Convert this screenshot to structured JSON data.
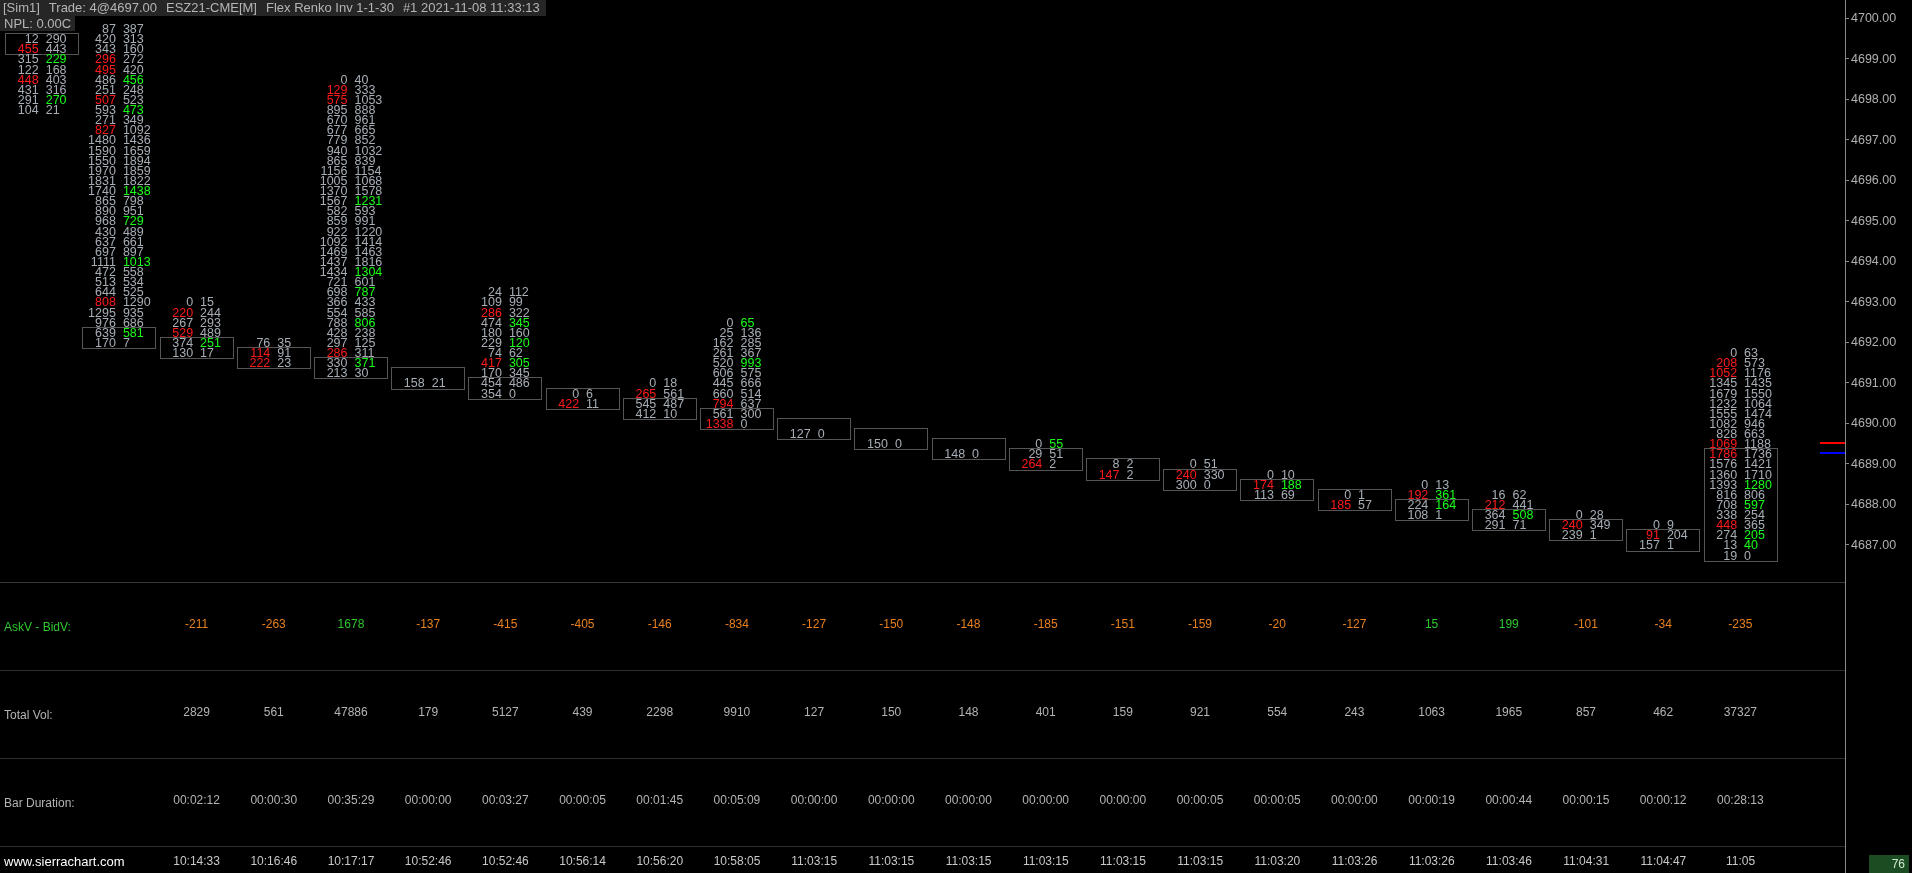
{
  "title_bar": {
    "segments": [
      "[Sim1]",
      "Trade: 4@4697.00",
      "ESZ21-CME[M]",
      "Flex Renko Inv 1-1-30",
      "#1 2021-11-08 11:33:13"
    ]
  },
  "npl": "NPL: 0.00C",
  "footprint": {
    "bars": [
      {
        "body": [
          {
            "bid": "12",
            "ask": "290",
            "bid_imb": false,
            "ask_imb": false
          },
          {
            "bid": "455",
            "ask": "443",
            "bid_imb": true,
            "ask_imb": false
          }
        ],
        "lower": [
          {
            "bid": "315",
            "ask": "229",
            "bid_imb": false,
            "ask_imb": true
          },
          {
            "bid": "122",
            "ask": "168",
            "bid_imb": false,
            "ask_imb": false
          },
          {
            "bid": "448",
            "ask": "403",
            "bid_imb": true,
            "ask_imb": false
          },
          {
            "bid": "431",
            "ask": "316",
            "bid_imb": false,
            "ask_imb": false
          },
          {
            "bid": "291",
            "ask": "270",
            "bid_imb": false,
            "ask_imb": true
          },
          {
            "bid": "104",
            "ask": "21",
            "bid_imb": false,
            "ask_imb": false
          }
        ]
      },
      {
        "upper": [
          {
            "bid": "87",
            "ask": "387",
            "bid_imb": false,
            "ask_imb": false
          },
          {
            "bid": "420",
            "ask": "313",
            "bid_imb": false,
            "ask_imb": false
          },
          {
            "bid": "343",
            "ask": "160",
            "bid_imb": false,
            "ask_imb": false
          },
          {
            "bid": "296",
            "ask": "272",
            "bid_imb": true,
            "ask_imb": false
          },
          {
            "bid": "495",
            "ask": "420",
            "bid_imb": true,
            "ask_imb": false
          },
          {
            "bid": "486",
            "ask": "456",
            "bid_imb": false,
            "ask_imb": true
          },
          {
            "bid": "251",
            "ask": "248",
            "bid_imb": false,
            "ask_imb": false
          },
          {
            "bid": "507",
            "ask": "523",
            "bid_imb": true,
            "ask_imb": false
          },
          {
            "bid": "593",
            "ask": "473",
            "bid_imb": false,
            "ask_imb": true
          },
          {
            "bid": "271",
            "ask": "349",
            "bid_imb": false,
            "ask_imb": false
          },
          {
            "bid": "827",
            "ask": "1092",
            "bid_imb": true,
            "ask_imb": false
          },
          {
            "bid": "1480",
            "ask": "1436",
            "bid_imb": false,
            "ask_imb": false
          },
          {
            "bid": "1590",
            "ask": "1659",
            "bid_imb": false,
            "ask_imb": false
          },
          {
            "bid": "1550",
            "ask": "1894",
            "bid_imb": false,
            "ask_imb": false
          },
          {
            "bid": "1970",
            "ask": "1859",
            "bid_imb": false,
            "ask_imb": false
          },
          {
            "bid": "1831",
            "ask": "1822",
            "bid_imb": false,
            "ask_imb": false
          },
          {
            "bid": "1740",
            "ask": "1438",
            "bid_imb": false,
            "ask_imb": true
          },
          {
            "bid": "865",
            "ask": "798",
            "bid_imb": false,
            "ask_imb": false
          },
          {
            "bid": "890",
            "ask": "951",
            "bid_imb": false,
            "ask_imb": false
          },
          {
            "bid": "968",
            "ask": "729",
            "bid_imb": false,
            "ask_imb": true
          },
          {
            "bid": "430",
            "ask": "489",
            "bid_imb": false,
            "ask_imb": false
          },
          {
            "bid": "637",
            "ask": "661",
            "bid_imb": false,
            "ask_imb": false
          },
          {
            "bid": "697",
            "ask": "897",
            "bid_imb": false,
            "ask_imb": false
          },
          {
            "bid": "1111",
            "ask": "1013",
            "bid_imb": false,
            "ask_imb": true
          },
          {
            "bid": "472",
            "ask": "558",
            "bid_imb": false,
            "ask_imb": false
          },
          {
            "bid": "513",
            "ask": "534",
            "bid_imb": false,
            "ask_imb": false
          },
          {
            "bid": "644",
            "ask": "525",
            "bid_imb": false,
            "ask_imb": false
          },
          {
            "bid": "808",
            "ask": "1290",
            "bid_imb": true,
            "ask_imb": false
          },
          {
            "bid": "1295",
            "ask": "935",
            "bid_imb": false,
            "ask_imb": false
          },
          {
            "bid": "976",
            "ask": "686",
            "bid_imb": false,
            "ask_imb": false
          }
        ],
        "body": [
          {
            "bid": "639",
            "ask": "581",
            "bid_imb": false,
            "ask_imb": true
          },
          {
            "bid": "170",
            "ask": "7",
            "bid_imb": false,
            "ask_imb": false
          }
        ]
      },
      {
        "upper": [
          {
            "bid": "0",
            "ask": "15",
            "bid_imb": false,
            "ask_imb": false
          },
          {
            "bid": "220",
            "ask": "244",
            "bid_imb": true,
            "ask_imb": false
          },
          {
            "bid": "267",
            "ask": "293",
            "bid_imb": false,
            "ask_imb": false
          },
          {
            "bid": "529",
            "ask": "489",
            "bid_imb": true,
            "ask_imb": false
          }
        ],
        "body": [
          {
            "bid": "374",
            "ask": "251",
            "bid_imb": false,
            "ask_imb": true
          },
          {
            "bid": "130",
            "ask": "17",
            "bid_imb": false,
            "ask_imb": false
          }
        ]
      },
      {
        "upper": [
          {
            "bid": "76",
            "ask": "35",
            "bid_imb": false,
            "ask_imb": false
          }
        ],
        "body": [
          {
            "bid": "114",
            "ask": "91",
            "bid_imb": true,
            "ask_imb": false
          },
          {
            "bid": "222",
            "ask": "23",
            "bid_imb": true,
            "ask_imb": false
          }
        ]
      },
      {
        "upper": [
          {
            "bid": "0",
            "ask": "40",
            "bid_imb": false,
            "ask_imb": false
          },
          {
            "bid": "129",
            "ask": "333",
            "bid_imb": true,
            "ask_imb": false
          },
          {
            "bid": "575",
            "ask": "1053",
            "bid_imb": true,
            "ask_imb": false
          },
          {
            "bid": "895",
            "ask": "888",
            "bid_imb": false,
            "ask_imb": false
          },
          {
            "bid": "670",
            "ask": "961",
            "bid_imb": false,
            "ask_imb": false
          },
          {
            "bid": "677",
            "ask": "665",
            "bid_imb": false,
            "ask_imb": false
          },
          {
            "bid": "779",
            "ask": "852",
            "bid_imb": false,
            "ask_imb": false
          },
          {
            "bid": "940",
            "ask": "1032",
            "bid_imb": false,
            "ask_imb": false
          },
          {
            "bid": "865",
            "ask": "839",
            "bid_imb": false,
            "ask_imb": false
          },
          {
            "bid": "1156",
            "ask": "1154",
            "bid_imb": false,
            "ask_imb": false
          },
          {
            "bid": "1005",
            "ask": "1068",
            "bid_imb": false,
            "ask_imb": false
          },
          {
            "bid": "1370",
            "ask": "1578",
            "bid_imb": false,
            "ask_imb": false
          },
          {
            "bid": "1567",
            "ask": "1231",
            "bid_imb": false,
            "ask_imb": true
          },
          {
            "bid": "582",
            "ask": "593",
            "bid_imb": false,
            "ask_imb": false
          },
          {
            "bid": "859",
            "ask": "991",
            "bid_imb": false,
            "ask_imb": false
          },
          {
            "bid": "922",
            "ask": "1220",
            "bid_imb": false,
            "ask_imb": false
          },
          {
            "bid": "1092",
            "ask": "1414",
            "bid_imb": false,
            "ask_imb": false
          },
          {
            "bid": "1469",
            "ask": "1463",
            "bid_imb": false,
            "ask_imb": false
          },
          {
            "bid": "1437",
            "ask": "1816",
            "bid_imb": false,
            "ask_imb": false
          },
          {
            "bid": "1434",
            "ask": "1304",
            "bid_imb": false,
            "ask_imb": true
          },
          {
            "bid": "721",
            "ask": "601",
            "bid_imb": false,
            "ask_imb": false
          },
          {
            "bid": "698",
            "ask": "787",
            "bid_imb": false,
            "ask_imb": true
          },
          {
            "bid": "366",
            "ask": "433",
            "bid_imb": false,
            "ask_imb": false
          },
          {
            "bid": "554",
            "ask": "585",
            "bid_imb": false,
            "ask_imb": false
          },
          {
            "bid": "788",
            "ask": "806",
            "bid_imb": false,
            "ask_imb": true
          },
          {
            "bid": "428",
            "ask": "238",
            "bid_imb": false,
            "ask_imb": false
          },
          {
            "bid": "297",
            "ask": "125",
            "bid_imb": false,
            "ask_imb": false
          },
          {
            "bid": "286",
            "ask": "311",
            "bid_imb": true,
            "ask_imb": false
          }
        ],
        "body": [
          {
            "bid": "330",
            "ask": "371",
            "bid_imb": false,
            "ask_imb": true
          },
          {
            "bid": "213",
            "ask": "30",
            "bid_imb": false,
            "ask_imb": false
          }
        ]
      },
      {
        "body": [
          {
            "bid": "158",
            "ask": "21",
            "bid_imb": false,
            "ask_imb": false
          }
        ]
      },
      {
        "upper": [
          {
            "bid": "24",
            "ask": "112",
            "bid_imb": false,
            "ask_imb": false
          },
          {
            "bid": "109",
            "ask": "99",
            "bid_imb": false,
            "ask_imb": false
          },
          {
            "bid": "286",
            "ask": "322",
            "bid_imb": true,
            "ask_imb": false
          },
          {
            "bid": "474",
            "ask": "345",
            "bid_imb": false,
            "ask_imb": true
          },
          {
            "bid": "180",
            "ask": "160",
            "bid_imb": false,
            "ask_imb": false
          },
          {
            "bid": "229",
            "ask": "120",
            "bid_imb": false,
            "ask_imb": true
          },
          {
            "bid": "74",
            "ask": "62",
            "bid_imb": false,
            "ask_imb": false
          },
          {
            "bid": "417",
            "ask": "305",
            "bid_imb": true,
            "ask_imb": true
          },
          {
            "bid": "170",
            "ask": "345",
            "bid_imb": false,
            "ask_imb": false
          }
        ],
        "body": [
          {
            "bid": "454",
            "ask": "486",
            "bid_imb": false,
            "ask_imb": false
          },
          {
            "bid": "354",
            "ask": "0",
            "bid_imb": false,
            "ask_imb": false
          }
        ]
      },
      {
        "body": [
          {
            "bid": "0",
            "ask": "6",
            "bid_imb": false,
            "ask_imb": false
          },
          {
            "bid": "422",
            "ask": "11",
            "bid_imb": true,
            "ask_imb": false
          }
        ]
      },
      {
        "upper": [
          {
            "bid": "0",
            "ask": "18",
            "bid_imb": false,
            "ask_imb": false
          },
          {
            "bid": "265",
            "ask": "561",
            "bid_imb": true,
            "ask_imb": false
          }
        ],
        "body": [
          {
            "bid": "545",
            "ask": "487",
            "bid_imb": false,
            "ask_imb": false
          },
          {
            "bid": "412",
            "ask": "10",
            "bid_imb": false,
            "ask_imb": false
          }
        ]
      },
      {
        "upper": [
          {
            "bid": "0",
            "ask": "65",
            "bid_imb": false,
            "ask_imb": true
          },
          {
            "bid": "25",
            "ask": "136",
            "bid_imb": false,
            "ask_imb": false
          },
          {
            "bid": "162",
            "ask": "285",
            "bid_imb": false,
            "ask_imb": false
          },
          {
            "bid": "261",
            "ask": "367",
            "bid_imb": false,
            "ask_imb": false
          },
          {
            "bid": "520",
            "ask": "993",
            "bid_imb": false,
            "ask_imb": true
          },
          {
            "bid": "606",
            "ask": "575",
            "bid_imb": false,
            "ask_imb": false
          },
          {
            "bid": "445",
            "ask": "666",
            "bid_imb": false,
            "ask_imb": false
          },
          {
            "bid": "660",
            "ask": "514",
            "bid_imb": false,
            "ask_imb": false
          },
          {
            "bid": "794",
            "ask": "637",
            "bid_imb": true,
            "ask_imb": false
          }
        ],
        "body": [
          {
            "bid": "561",
            "ask": "300",
            "bid_imb": false,
            "ask_imb": false
          },
          {
            "bid": "1338",
            "ask": "0",
            "bid_imb": true,
            "ask_imb": false
          }
        ]
      },
      {
        "body": [
          {
            "bid": "127",
            "ask": "0",
            "bid_imb": false,
            "ask_imb": false
          }
        ]
      },
      {
        "body": [
          {
            "bid": "150",
            "ask": "0",
            "bid_imb": false,
            "ask_imb": false
          }
        ]
      },
      {
        "body": [
          {
            "bid": "148",
            "ask": "0",
            "bid_imb": false,
            "ask_imb": false
          }
        ]
      },
      {
        "upper": [
          {
            "bid": "0",
            "ask": "55",
            "bid_imb": false,
            "ask_imb": true
          }
        ],
        "body": [
          {
            "bid": "29",
            "ask": "51",
            "bid_imb": false,
            "ask_imb": false
          },
          {
            "bid": "264",
            "ask": "2",
            "bid_imb": true,
            "ask_imb": false
          }
        ]
      },
      {
        "body": [
          {
            "bid": "8",
            "ask": "2",
            "bid_imb": false,
            "ask_imb": false
          },
          {
            "bid": "147",
            "ask": "2",
            "bid_imb": true,
            "ask_imb": false
          }
        ]
      },
      {
        "upper": [
          {
            "bid": "0",
            "ask": "51",
            "bid_imb": false,
            "ask_imb": false
          }
        ],
        "body": [
          {
            "bid": "240",
            "ask": "330",
            "bid_imb": true,
            "ask_imb": false
          },
          {
            "bid": "300",
            "ask": "0",
            "bid_imb": false,
            "ask_imb": false
          }
        ]
      },
      {
        "upper": [
          {
            "bid": "0",
            "ask": "10",
            "bid_imb": false,
            "ask_imb": false
          }
        ],
        "body": [
          {
            "bid": "174",
            "ask": "188",
            "bid_imb": true,
            "ask_imb": true
          },
          {
            "bid": "113",
            "ask": "69",
            "bid_imb": false,
            "ask_imb": false
          }
        ]
      },
      {
        "body": [
          {
            "bid": "0",
            "ask": "1",
            "bid_imb": false,
            "ask_imb": false
          },
          {
            "bid": "185",
            "ask": "57",
            "bid_imb": true,
            "ask_imb": false
          }
        ]
      },
      {
        "upper": [
          {
            "bid": "0",
            "ask": "13",
            "bid_imb": false,
            "ask_imb": false
          },
          {
            "bid": "192",
            "ask": "361",
            "bid_imb": true,
            "ask_imb": true
          }
        ],
        "body": [
          {
            "bid": "224",
            "ask": "164",
            "bid_imb": false,
            "ask_imb": true
          },
          {
            "bid": "108",
            "ask": "1",
            "bid_imb": false,
            "ask_imb": false
          }
        ]
      },
      {
        "upper": [
          {
            "bid": "16",
            "ask": "62",
            "bid_imb": false,
            "ask_imb": false
          },
          {
            "bid": "212",
            "ask": "441",
            "bid_imb": true,
            "ask_imb": false
          }
        ],
        "body": [
          {
            "bid": "364",
            "ask": "508",
            "bid_imb": false,
            "ask_imb": true
          },
          {
            "bid": "291",
            "ask": "71",
            "bid_imb": false,
            "ask_imb": false
          }
        ]
      },
      {
        "upper": [
          {
            "bid": "0",
            "ask": "28",
            "bid_imb": false,
            "ask_imb": false
          }
        ],
        "body": [
          {
            "bid": "240",
            "ask": "349",
            "bid_imb": true,
            "ask_imb": false
          },
          {
            "bid": "239",
            "ask": "1",
            "bid_imb": false,
            "ask_imb": false
          }
        ]
      },
      {
        "upper": [
          {
            "bid": "0",
            "ask": "9",
            "bid_imb": false,
            "ask_imb": false
          }
        ],
        "body": [
          {
            "bid": "91",
            "ask": "204",
            "bid_imb": true,
            "ask_imb": false
          },
          {
            "bid": "157",
            "ask": "1",
            "bid_imb": false,
            "ask_imb": false
          }
        ]
      },
      {
        "upper": [
          {
            "bid": "0",
            "ask": "63",
            "bid_imb": false,
            "ask_imb": false
          },
          {
            "bid": "208",
            "ask": "573",
            "bid_imb": true,
            "ask_imb": false
          },
          {
            "bid": "1052",
            "ask": "1176",
            "bid_imb": true,
            "ask_imb": false
          },
          {
            "bid": "1345",
            "ask": "1435",
            "bid_imb": false,
            "ask_imb": false
          },
          {
            "bid": "1679",
            "ask": "1550",
            "bid_imb": false,
            "ask_imb": false
          },
          {
            "bid": "1232",
            "ask": "1064",
            "bid_imb": false,
            "ask_imb": false
          },
          {
            "bid": "1555",
            "ask": "1474",
            "bid_imb": false,
            "ask_imb": false
          },
          {
            "bid": "1082",
            "ask": "946",
            "bid_imb": false,
            "ask_imb": false
          },
          {
            "bid": "828",
            "ask": "663",
            "bid_imb": false,
            "ask_imb": false
          },
          {
            "bid": "1069",
            "ask": "1188",
            "bid_imb": true,
            "ask_imb": false
          }
        ],
        "body": [
          {
            "bid": "1786",
            "ask": "1736",
            "bid_imb": true,
            "ask_imb": false
          },
          {
            "bid": "1576",
            "ask": "1421",
            "bid_imb": false,
            "ask_imb": false
          },
          {
            "bid": "1360",
            "ask": "1710",
            "bid_imb": false,
            "ask_imb": false
          },
          {
            "bid": "1393",
            "ask": "1280",
            "bid_imb": false,
            "ask_imb": true
          },
          {
            "bid": "816",
            "ask": "806",
            "bid_imb": false,
            "ask_imb": false
          },
          {
            "bid": "708",
            "ask": "597",
            "bid_imb": false,
            "ask_imb": true
          },
          {
            "bid": "338",
            "ask": "254",
            "bid_imb": false,
            "ask_imb": false
          },
          {
            "bid": "448",
            "ask": "365",
            "bid_imb": true,
            "ask_imb": false
          },
          {
            "bid": "274",
            "ask": "205",
            "bid_imb": false,
            "ask_imb": true
          },
          {
            "bid": "13",
            "ask": "40",
            "bid_imb": false,
            "ask_imb": true
          },
          {
            "bid": "19",
            "ask": "0",
            "bid_imb": false,
            "ask_imb": false
          }
        ]
      }
    ]
  },
  "price_axis": {
    "labels": [
      "4700.00",
      "4699.00",
      "4698.00",
      "4697.00",
      "4696.00",
      "4695.00",
      "4694.00",
      "4693.00",
      "4692.00",
      "4691.00",
      "4690.00",
      "4689.00",
      "4688.00",
      "4687.00"
    ],
    "corner_value": "76"
  },
  "stats_table": {
    "rows": [
      {
        "label": "AskV - BidV:",
        "kind": "delta",
        "color": "#2ec82e",
        "cells": [
          {
            "text": "-211",
            "color": "#e8801e"
          },
          {
            "text": "-263",
            "color": "#e8801e"
          },
          {
            "text": "1678",
            "color": "#2ec82e"
          },
          {
            "text": "-137",
            "color": "#e8801e"
          },
          {
            "text": "-415",
            "color": "#e8801e"
          },
          {
            "text": "-405",
            "color": "#e8801e"
          },
          {
            "text": "-146",
            "color": "#e8801e"
          },
          {
            "text": "-834",
            "color": "#e8801e"
          },
          {
            "text": "-127",
            "color": "#e8801e"
          },
          {
            "text": "-150",
            "color": "#e8801e"
          },
          {
            "text": "-148",
            "color": "#e8801e"
          },
          {
            "text": "-185",
            "color": "#e8801e"
          },
          {
            "text": "-151",
            "color": "#e8801e"
          },
          {
            "text": "-159",
            "color": "#e8801e"
          },
          {
            "text": "-20",
            "color": "#e8801e"
          },
          {
            "text": "-127",
            "color": "#e8801e"
          },
          {
            "text": "15",
            "color": "#2ec82e"
          },
          {
            "text": "199",
            "color": "#2ec82e"
          },
          {
            "text": "-101",
            "color": "#e8801e"
          },
          {
            "text": "-34",
            "color": "#e8801e"
          },
          {
            "text": "-235",
            "color": "#e8801e"
          }
        ]
      },
      {
        "label": "Total Vol:",
        "kind": "plain",
        "color": "#b4b4b4",
        "cells": [
          "2829",
          "561",
          "47886",
          "179",
          "5127",
          "439",
          "2298",
          "9910",
          "127",
          "150",
          "148",
          "401",
          "159",
          "921",
          "554",
          "243",
          "1063",
          "1965",
          "857",
          "462",
          "37327"
        ]
      },
      {
        "label": "Bar Duration:",
        "kind": "plain",
        "color": "#b4b4b4",
        "cells": [
          "00:02:12",
          "00:00:30",
          "00:35:29",
          "00:00:00",
          "00:03:27",
          "00:00:05",
          "00:01:45",
          "00:05:09",
          "00:00:00",
          "00:00:00",
          "00:00:00",
          "00:00:00",
          "00:00:00",
          "00:00:05",
          "00:00:05",
          "00:00:00",
          "00:00:19",
          "00:00:44",
          "00:00:15",
          "00:00:12",
          "00:28:13"
        ]
      }
    ]
  },
  "time_axis": {
    "site": "www.sierrachart.com",
    "labels": [
      "10:14:33",
      "10:16:46",
      "10:17:17",
      "10:52:46",
      "10:52:46",
      "10:56:14",
      "10:56:20",
      "10:58:05",
      "11:03:15",
      "11:03:15",
      "11:03:15",
      "11:03:15",
      "11:03:15",
      "11:03:15",
      "11:03:20",
      "11:03:26",
      "11:03:26",
      "11:03:46",
      "11:04:31",
      "11:04:47",
      "11:05"
    ]
  }
}
